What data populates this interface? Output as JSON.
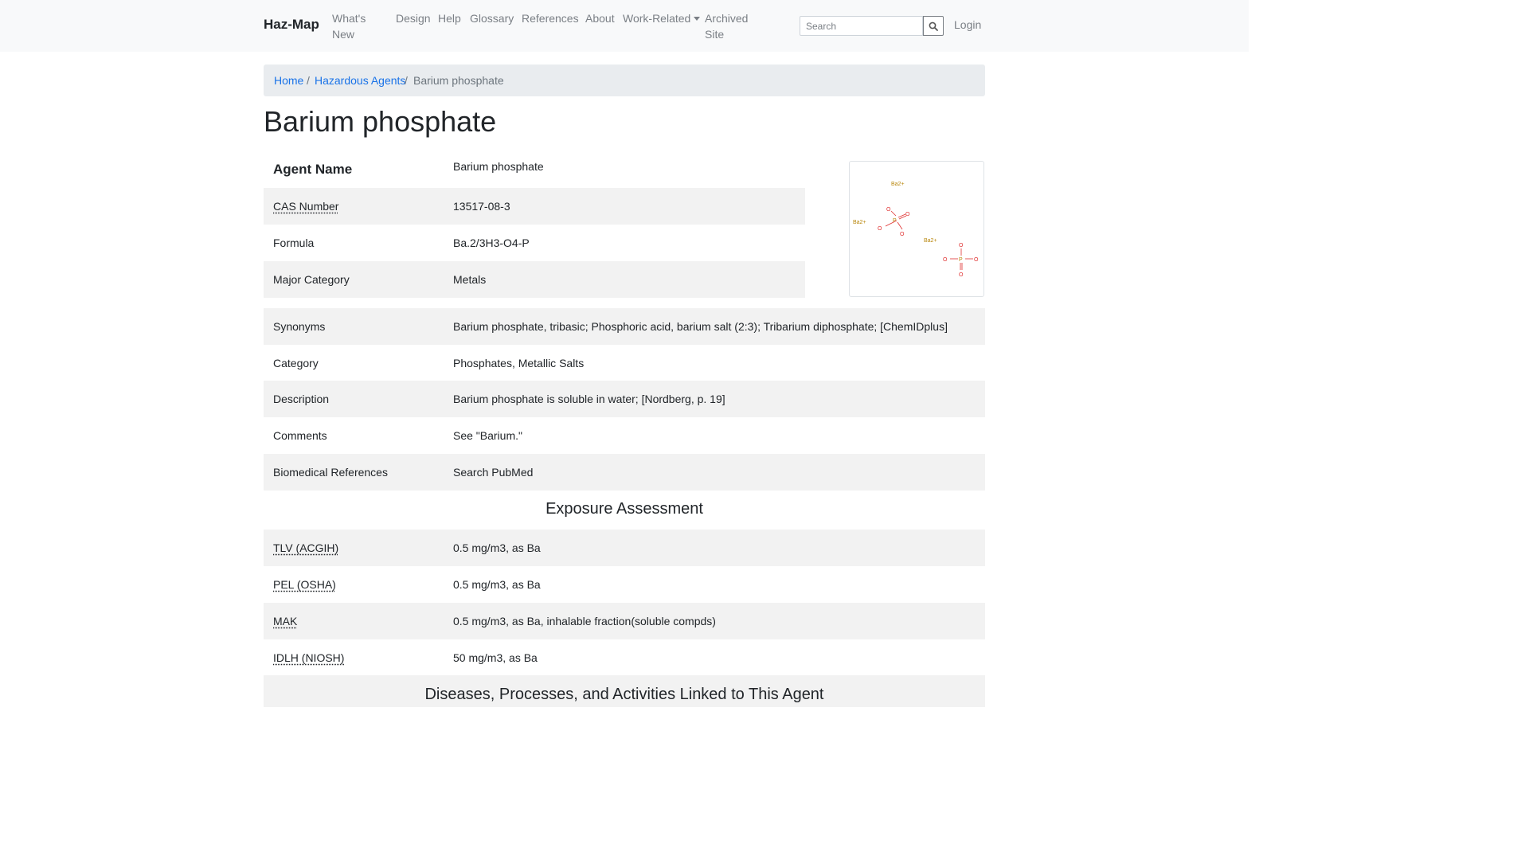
{
  "nav": {
    "brand": "Haz-Map",
    "items": [
      "What's New",
      "Design",
      "Help",
      "Glossary",
      "References",
      "About"
    ],
    "work_related": "Work-Related",
    "archived": "Archived Site",
    "search_placeholder": "Search",
    "login": "Login"
  },
  "breadcrumb": {
    "home": "Home",
    "section": "Hazardous Agents",
    "current": "Barium phosphate"
  },
  "page_title": "Barium phosphate",
  "agent": {
    "name_label": "Agent Name",
    "name_value": "Barium phosphate",
    "rows": [
      {
        "label": "CAS Number",
        "value": "13517-08-3"
      },
      {
        "label": "Formula",
        "value": "Ba.2/3H3-O4-P"
      },
      {
        "label": "Major Category",
        "value": "Metals"
      }
    ]
  },
  "structure": {
    "atoms": [
      "Ba2+",
      "Ba2+",
      "Ba2+",
      "P",
      "O",
      "O",
      "O",
      "O",
      "P",
      "O",
      "O",
      "O",
      "O"
    ]
  },
  "details": [
    {
      "label": "Synonyms",
      "value": "Barium phosphate, tribasic; Phosphoric acid, barium salt (2:3); Tribarium diphosphate; [ChemIDplus]"
    },
    {
      "label": "Category",
      "value": "Phosphates, Metallic Salts"
    },
    {
      "label": "Description",
      "value": "Barium phosphate is soluble in water; [Nordberg, p. 19]"
    },
    {
      "label": "Comments",
      "value": "See \"Barium.\""
    },
    {
      "label": "Biomedical References",
      "value": "Search PubMed"
    }
  ],
  "exposure": {
    "title": "Exposure Assessment",
    "rows": [
      {
        "label": "TLV (ACGIH)",
        "value": "0.5 mg/m3, as Ba"
      },
      {
        "label": "PEL (OSHA)",
        "value": "0.5 mg/m3, as Ba"
      },
      {
        "label": "MAK",
        "value": "0.5 mg/m3, as Ba, inhalable fraction(soluble compds)"
      },
      {
        "label": "IDLH (NIOSH)",
        "value": "50 mg/m3, as Ba"
      }
    ]
  },
  "diseases_title": "Diseases, Processes, and Activities Linked to This Agent",
  "colors": {
    "link": "#1a73e8",
    "navbar_bg": "#f8f9fa",
    "row_shade": "#f2f2f2",
    "oxygen": "#e03030",
    "barium": "#b8860b"
  }
}
